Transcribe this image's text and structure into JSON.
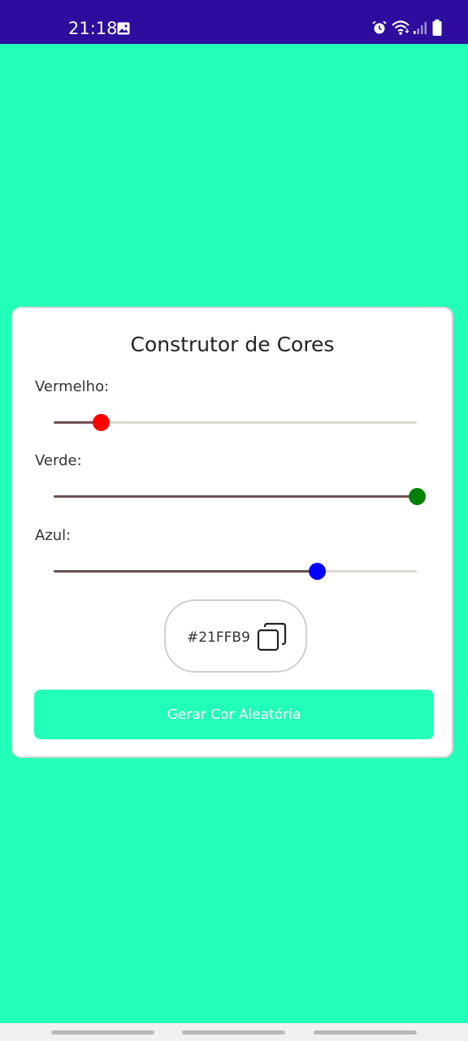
{
  "status_bar": {
    "time": "21:18",
    "left_icons": [
      "image-notification-icon"
    ],
    "right_icons": [
      "alarm-icon",
      "wifi-icon",
      "signal-icon",
      "battery-icon"
    ],
    "background": "#2D0C9E"
  },
  "app": {
    "background_color": "#21FFB9",
    "title": "Construtor de Cores",
    "sliders": [
      {
        "label": "Vermelho:",
        "value": 33,
        "max": 255,
        "thumb_color": "#ff0000"
      },
      {
        "label": "Verde:",
        "value": 255,
        "max": 255,
        "thumb_color": "#008000"
      },
      {
        "label": "Azul:",
        "value": 185,
        "max": 255,
        "thumb_color": "#0000ff"
      }
    ],
    "hex_value": "#21FFB9",
    "copy_icon": "copy-icon",
    "random_button_label": "Gerar Cor Aleatória",
    "random_button_color": "#21FFB9"
  },
  "nav_bar": {
    "pills": 3
  }
}
